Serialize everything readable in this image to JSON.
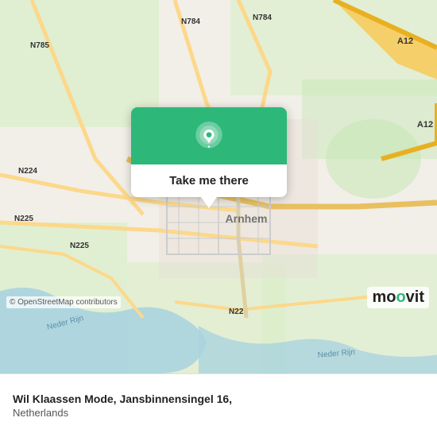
{
  "map": {
    "popup": {
      "button_label": "Take me there"
    },
    "credit": "© OpenStreetMap contributors",
    "city_label": "Arnhem",
    "road_labels": [
      "N784",
      "N785",
      "A12",
      "N224",
      "N225",
      "N225",
      "N225"
    ],
    "river_name": "Nederrijn"
  },
  "info_bar": {
    "title": "Wil Klaassen Mode, Jansbinnensingel 16,",
    "subtitle": "Netherlands"
  },
  "logo": {
    "text_black": "moovit",
    "accent_letter": "o"
  }
}
